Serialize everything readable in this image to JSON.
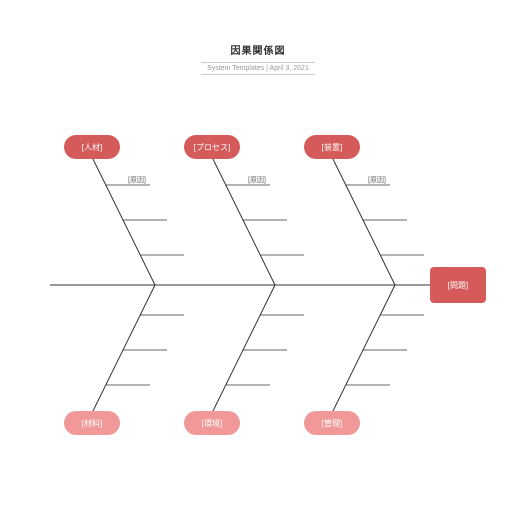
{
  "header": {
    "title": "因果関係図",
    "subtitle": "System Templates  |  April 3, 2021"
  },
  "categories": {
    "top": [
      {
        "label": "[人材]"
      },
      {
        "label": "[プロセス]"
      },
      {
        "label": "[装置]"
      }
    ],
    "bottom": [
      {
        "label": "[材料]"
      },
      {
        "label": "[環境]"
      },
      {
        "label": "[管理]"
      }
    ]
  },
  "causeLabel": "[原因]",
  "problem": {
    "label": "[問題]"
  }
}
